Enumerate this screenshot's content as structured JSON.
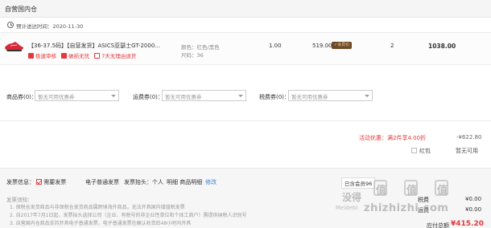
{
  "header": {
    "title": "自营国内仓"
  },
  "delivery": {
    "text": "预计送达时间：2020-11-30"
  },
  "item": {
    "name": "【36-37.5码】【自营发货】ASICS亚瑟士GT-2000...",
    "tags": [
      "极速审核",
      "破损无忧",
      "7天无理由退货"
    ],
    "color": "颜色：红色/黑色",
    "size": "尺码：36",
    "rate": "1.00",
    "price": "519.00",
    "member_badge": "✓会员价",
    "qty": "2",
    "total": "1038.00"
  },
  "coupons": [
    {
      "label": "商品券(0)：",
      "placeholder": "暂无可用优惠券"
    },
    {
      "label": "运费券(0)：",
      "placeholder": "暂无可用优惠券"
    },
    {
      "label": "税费券(0)：",
      "placeholder": "暂无可用优惠券"
    }
  ],
  "promotion": {
    "label": "活动优惠：",
    "detail": "满2件享4.00折",
    "amount": "-¥622.80"
  },
  "red_packet": {
    "label": "红包",
    "value": "暂无可用"
  },
  "invoice": {
    "label": "发票信息：",
    "need": "需要发票",
    "type": "电子普通发票",
    "title_label": "发票抬头：个人",
    "detail_label": "明细 商品明细",
    "edit": "修改"
  },
  "notes": {
    "heading": "发票须知：",
    "lines": [
      "1. 保税仓发货商品与非保税仓发货商品属跨境海外商品，无法开具国内增值税发票",
      "2. 自2017年7月1日起，发票抬头选择公司（企业、有税号的非企业性单位和个体工商户）需提供纳税人识别号",
      "3. 自营国内仓商品支持开具电子普通发票，电子普通发票在确认收货后48小时内开具"
    ]
  },
  "summary": {
    "member_label": "已含会员96",
    "tax_label": "税费",
    "freight_label": "运费",
    "tax_value": "¥0.00",
    "freight_value": "¥0.00",
    "total_label": "应付总额",
    "total_value": "¥415.20"
  },
  "watermark": {
    "text": "值",
    "slogan": "没得",
    "sub": "Meidebi",
    "site": "zhizhizhi.com"
  },
  "colors": {
    "accent_red": "#e4393c",
    "header_bg": "#f5f5f5",
    "badge_bg": "#6b4b2a"
  }
}
